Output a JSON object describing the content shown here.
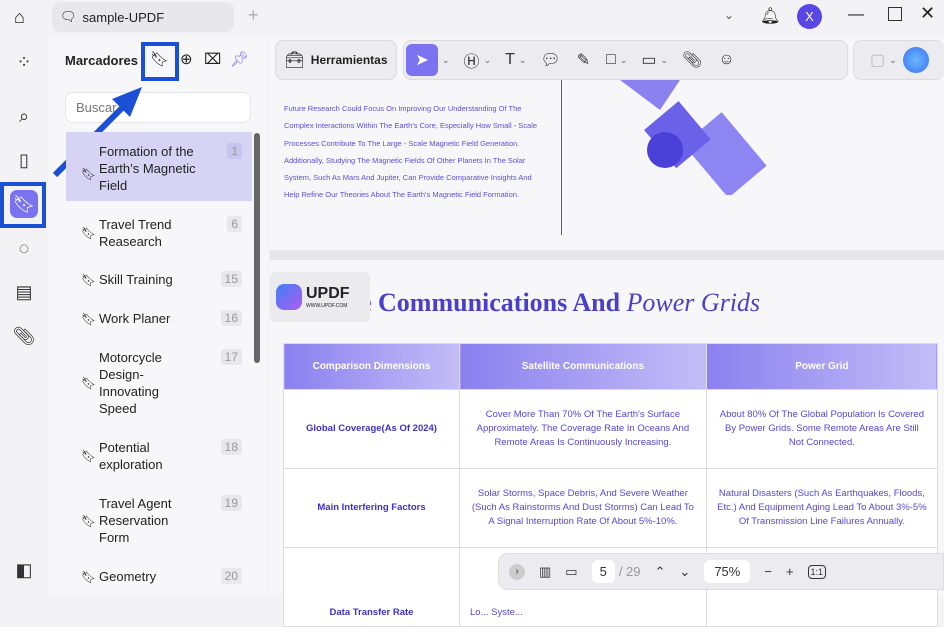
{
  "tab": {
    "title": "sample-UPDF"
  },
  "user": {
    "avatar_letter": "X"
  },
  "panel": {
    "title": "Marcadores",
    "search_placeholder": "Buscar"
  },
  "bookmarks": [
    {
      "label": "Formation of the Earth’s Magnetic Field",
      "page": "1"
    },
    {
      "label": "Travel Trend Reasearch",
      "page": "6"
    },
    {
      "label": "Skill Training",
      "page": "15"
    },
    {
      "label": "Work Planer",
      "page": "16"
    },
    {
      "label": "Motorcycle Design-Innovating Speed",
      "page": "17"
    },
    {
      "label": "Potential exploration",
      "page": "18"
    },
    {
      "label": "Travel Agent Reservation Form",
      "page": "19"
    },
    {
      "label": "Geometry",
      "page": "20"
    }
  ],
  "toolbar": {
    "tools_label": "Herramientas"
  },
  "document": {
    "paragraph": "Future Research Could Focus On Improving Our Understanding Of The Complex Interactions Within The Earth's Core, Especially How Small - Scale Processes Contribute To The Large - Scale Magnetic Field Generation. Additionally, Studying The Magnetic Fields Of Other Planets In The Solar System, Such As Mars And Jupiter, Can Provide Comparative Insights And Help Refine Our Theories About The Earth's Magnetic Field Formation.",
    "title_bold": "Satellite Communications And",
    "title_italic": "Power Grids",
    "logo_text": "UPDF",
    "logo_sub": "WWW.UPDF.COM",
    "table": {
      "headers": [
        "Comparison Dimensions",
        "Satellite Communications",
        "Power Grid"
      ],
      "rows": [
        [
          "Global Coverage(As Of 2024)",
          "Cover More Than 70% Of The Earth's Surface Approximately. The Coverage Rate In Oceans And Remote Areas Is Continuously Increasing.",
          "About 80% Of The Global Population Is Covered By Power Grids. Some Remote Areas Are Still Not Connected."
        ],
        [
          "Main Interfering Factors",
          "Solar Storms, Space Debris, And Severe Weather (Such As Rainstorms And Dust Storms) Can Lead To A Signal Interruption Rate Of About 5%-10%.",
          "Natural Disasters (Such As Earthquakes, Floods, Etc.) And Equipment Aging Lead To About 3%-5% Of Transmission Line Failures Annually."
        ],
        [
          "Data Transfer Rate",
          "Lo... Syste...",
          ""
        ]
      ]
    }
  },
  "footer": {
    "page": "5",
    "total": "/ 29",
    "zoom": "75%",
    "fit": "1:1"
  },
  "colors": {
    "accent": "#7b72f0",
    "annotation": "#1a4fd6"
  }
}
